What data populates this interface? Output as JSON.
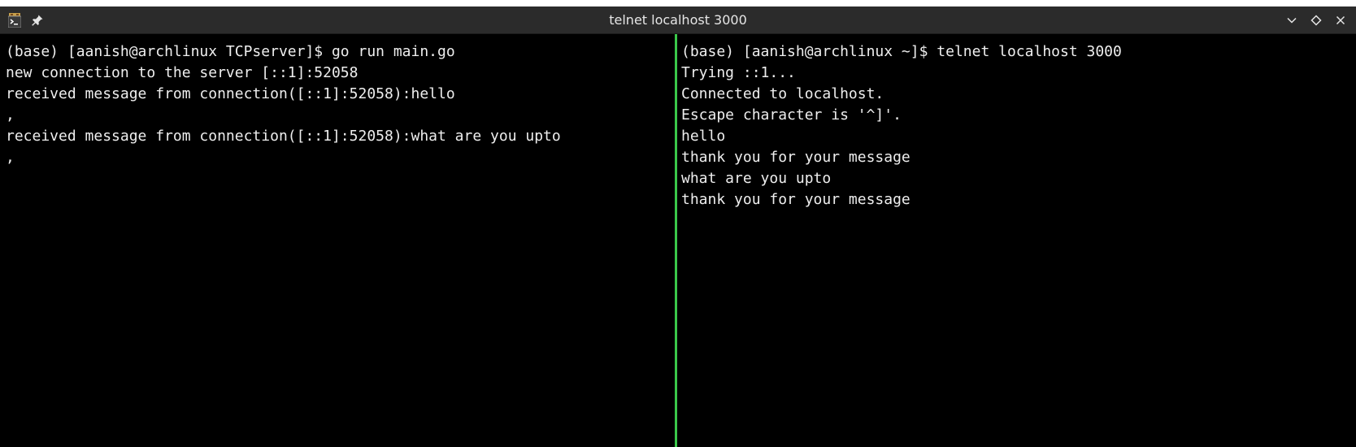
{
  "window": {
    "title": "telnet localhost 3000",
    "icons": {
      "app": "terminal-app-icon",
      "pin": "pin-icon",
      "minimize": "chevron-down-icon",
      "maximize": "diamond-icon",
      "close": "close-icon"
    }
  },
  "colors": {
    "terminal_bg": "#000000",
    "terminal_fg": "#eeeeee",
    "titlebar_bg": "#2b2b2b",
    "divider": "#3ac84a"
  },
  "left_pane": {
    "lines": [
      "(base) [aanish@archlinux TCPserver]$ go run main.go",
      "new connection to the server [::1]:52058",
      "received message from connection([::1]:52058):hello",
      ",",
      "received message from connection([::1]:52058):what are you upto",
      ","
    ]
  },
  "right_pane": {
    "lines": [
      "(base) [aanish@archlinux ~]$ telnet localhost 3000",
      "Trying ::1...",
      "Connected to localhost.",
      "Escape character is '^]'.",
      "hello",
      "thank you for your message",
      "what are you upto",
      "thank you for your message"
    ]
  }
}
